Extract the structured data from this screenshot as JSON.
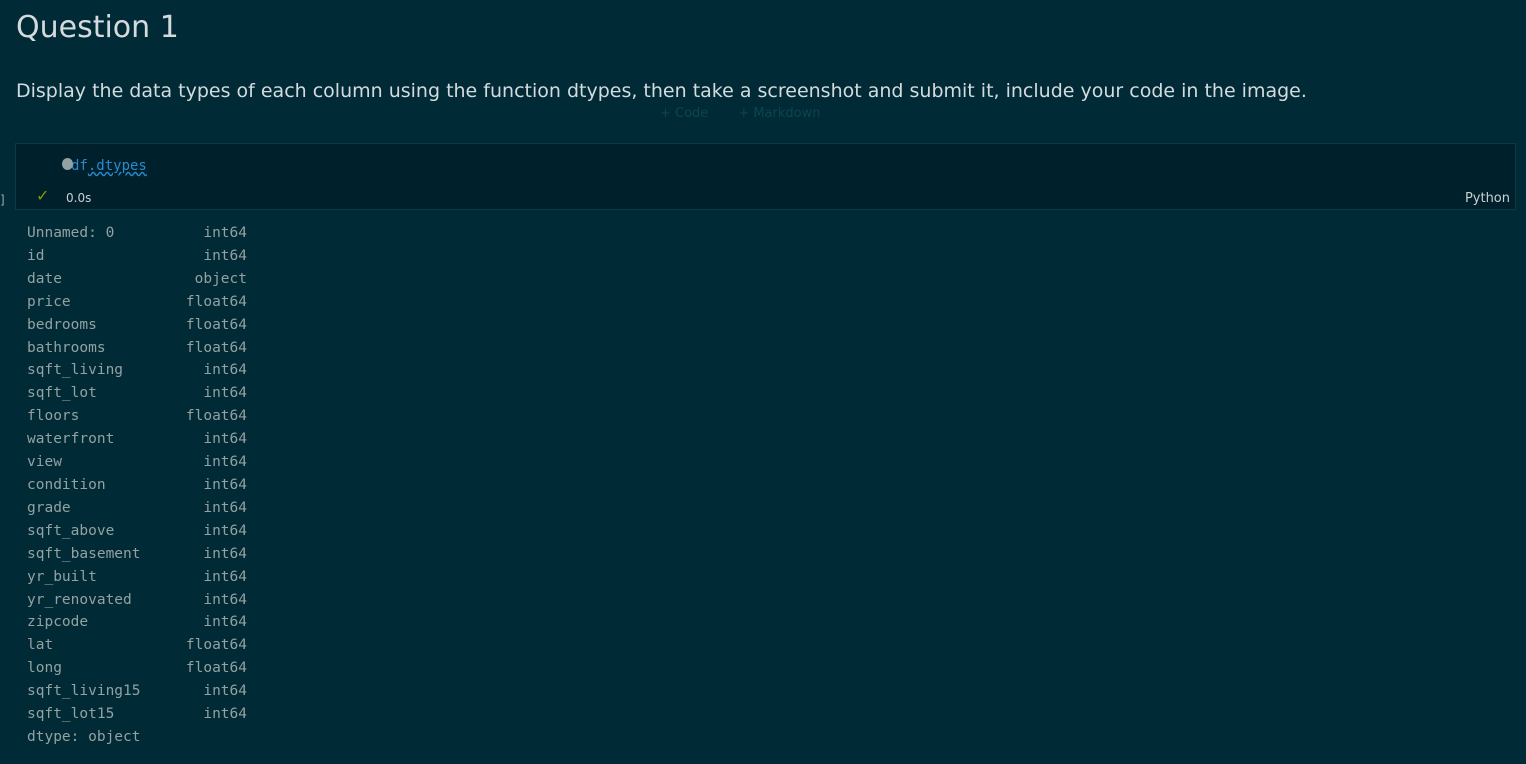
{
  "title": "Question 1",
  "description": "Display the data types of each column using the function dtypes, then take a screenshot and submit it, include your code in the image.",
  "toolbar": {
    "add_code": "+ Code",
    "add_markdown": "+ Markdown"
  },
  "cell": {
    "code_obj": "df",
    "code_member": ".dtypes",
    "status_time": "0.0s",
    "language": "Python",
    "bracket": "]"
  },
  "output": {
    "rows": [
      [
        "Unnamed: 0",
        "int64"
      ],
      [
        "id",
        "int64"
      ],
      [
        "date",
        "object"
      ],
      [
        "price",
        "float64"
      ],
      [
        "bedrooms",
        "float64"
      ],
      [
        "bathrooms",
        "float64"
      ],
      [
        "sqft_living",
        "int64"
      ],
      [
        "sqft_lot",
        "int64"
      ],
      [
        "floors",
        "float64"
      ],
      [
        "waterfront",
        "int64"
      ],
      [
        "view",
        "int64"
      ],
      [
        "condition",
        "int64"
      ],
      [
        "grade",
        "int64"
      ],
      [
        "sqft_above",
        "int64"
      ],
      [
        "sqft_basement",
        "int64"
      ],
      [
        "yr_built",
        "int64"
      ],
      [
        "yr_renovated",
        "int64"
      ],
      [
        "zipcode",
        "int64"
      ],
      [
        "lat",
        "float64"
      ],
      [
        "long",
        "float64"
      ],
      [
        "sqft_living15",
        "int64"
      ],
      [
        "sqft_lot15",
        "int64"
      ]
    ],
    "footer": "dtype: object"
  }
}
